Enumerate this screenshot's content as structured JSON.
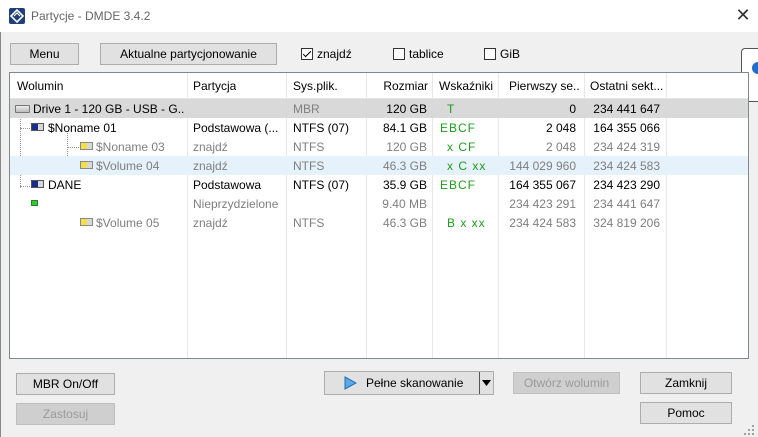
{
  "window": {
    "title": "Partycje - DMDE 3.4.2",
    "close_glyph": "✕"
  },
  "toolbar": {
    "menu_label": "Menu",
    "current_partitioning_label": "Aktualne partycjonowanie",
    "found_label": "znajdź",
    "found_checked": true,
    "tables_label": "tablice",
    "tables_checked": false,
    "gib_label": "GiB",
    "gib_checked": false
  },
  "columns": [
    "Wolumin",
    "Partycja",
    "Sys.plik.",
    "Rozmiar",
    "Wskaźniki",
    "Pierwszy se...",
    "Ostatni sekt..."
  ],
  "rows": [
    {
      "volume": "Drive 1 - 120 GB - USB - G...",
      "partition": "",
      "fs": "MBR",
      "size": "120 GB",
      "flags": "T",
      "first": "0",
      "last": "234 441 647"
    },
    {
      "volume": "$Noname 01",
      "partition": "Podstawowa (...",
      "fs": "NTFS (07)",
      "size": "84.1 GB",
      "flags": "EBCF",
      "first": "2 048",
      "last": "164 355 066"
    },
    {
      "volume": "$Noname 03",
      "partition": "znajdź",
      "fs": "NTFS",
      "size": "120 GB",
      "flags": "x CF",
      "first": "2 048",
      "last": "234 424 319"
    },
    {
      "volume": "$Volume 04",
      "partition": "znajdź",
      "fs": "NTFS",
      "size": "46.3 GB",
      "flags": "x C xx",
      "first": "144 029 960",
      "last": "234 424 583"
    },
    {
      "volume": "DANE",
      "partition": "Podstawowa",
      "fs": "NTFS (07)",
      "size": "35.9 GB",
      "flags": "EBCF",
      "first": "164 355 067",
      "last": "234 423 290"
    },
    {
      "volume": "",
      "partition": "Nieprzydzielone",
      "fs": "",
      "size": "9.40 MB",
      "flags": "",
      "first": "234 423 291",
      "last": "234 441 647"
    },
    {
      "volume": "$Volume 05",
      "partition": "znajdź",
      "fs": "NTFS",
      "size": "46.3 GB",
      "flags": "B x xx",
      "first": "234 424 583",
      "last": "324 819 206"
    }
  ],
  "buttons": {
    "mbr_onoff": "MBR On/Off",
    "apply": "Zastosuj",
    "full_scan": "Pełne skanowanie",
    "open_volume": "Otwórz wolumin",
    "close": "Zamknij",
    "help": "Pomoc"
  }
}
